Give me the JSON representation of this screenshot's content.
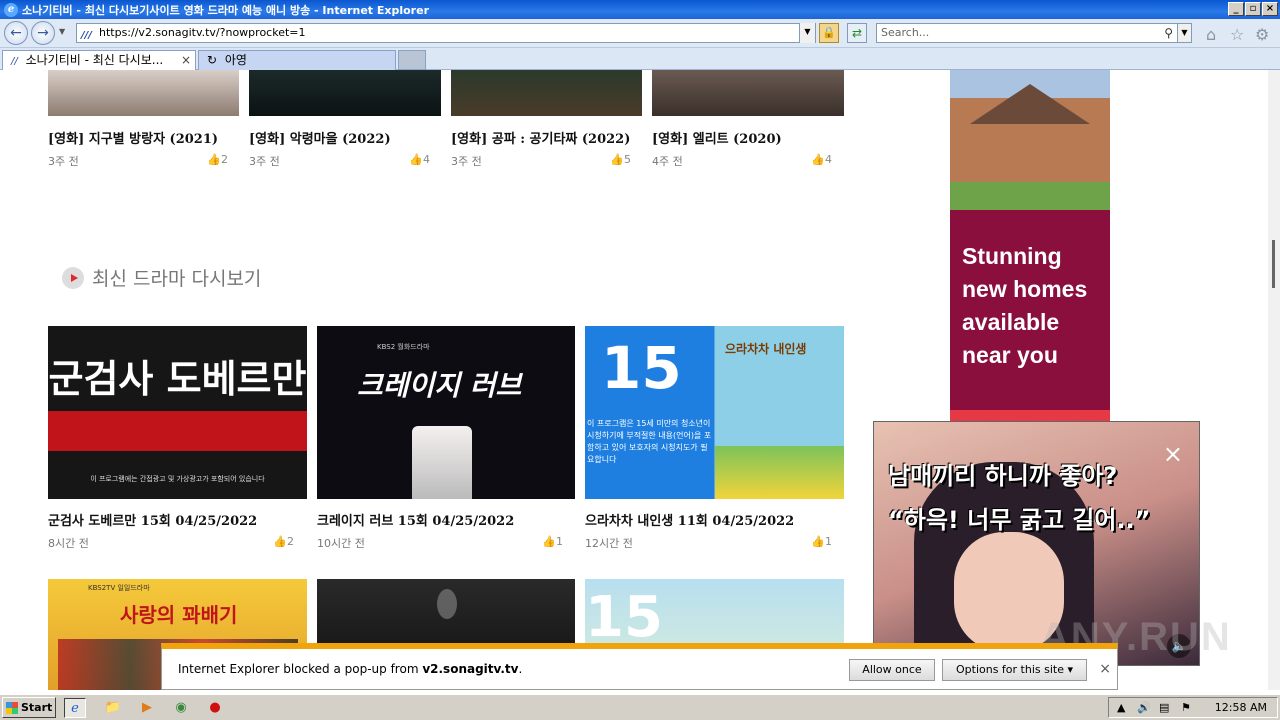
{
  "window": {
    "title": "소나기티비 - 최신 다시보기사이트 영화 드라마 예능 애니 방송 - Internet Explorer",
    "controls": [
      "_",
      "▫",
      "×"
    ]
  },
  "addressbar": {
    "url": "https://v2.sonagitv.tv/?nowprocket=1",
    "search_placeholder": "Search..."
  },
  "tabs": [
    {
      "label": "소나기티비 - 최신 다시보...",
      "active": true
    },
    {
      "label": "아영",
      "active": false
    }
  ],
  "top_movies": [
    {
      "title": "[영화] 지구별 방랑자 (2021)",
      "time": "3주 전",
      "likes": "2"
    },
    {
      "title": "[영화] 악령마을 (2022)",
      "time": "3주 전",
      "likes": "4"
    },
    {
      "title": "[영화] 공파 : 공기타짜 (2022)",
      "time": "3주 전",
      "likes": "5"
    },
    {
      "title": "[영화] 엘리트 (2020)",
      "time": "4주 전",
      "likes": "4"
    }
  ],
  "section": {
    "title": "최신 드라마 다시보기"
  },
  "dramas": [
    {
      "title": "군검사 도베르만 15회 04/25/2022",
      "time": "8시간 전",
      "likes": "2",
      "poster_text": "군검사 도베르만",
      "poster_sub": "이 프로그램에는 간접광고 및 가상광고가 포함되어 있습니다",
      "color": "#1a1a1a"
    },
    {
      "title": "크레이지 러브 15회 04/25/2022",
      "time": "10시간 전",
      "likes": "1",
      "poster_text": "크레이지 러브",
      "poster_sub": "KBS2 월화드라마",
      "color": "#0d0d12"
    },
    {
      "title": "으라차차 내인생 11회 04/25/2022",
      "time": "12시간 전",
      "likes": "1",
      "poster_text": "15",
      "poster_sub": "이 프로그램은 15세 미만의 청소년이 시청하기에 부적절한 내용(언어)을 포함하고 있어 보호자의 시청지도가 필요합니다",
      "poster_title2": "으라차차 내인생",
      "color": "#1e6fd0"
    }
  ],
  "row3": [
    {
      "poster_text": "사랑의 꽈배기",
      "poster_sub": "KBS2TV 일일드라마"
    },
    {
      "poster_text": ""
    },
    {
      "poster_text": "15"
    }
  ],
  "ad": {
    "text": "Stunning new homes available near you"
  },
  "popup_ad": {
    "line1": "남매끼리 하니까 좋아?",
    "line2": "“하윽! 너무 굵고 길어..”"
  },
  "watermark": "ANY.RUN",
  "notification": {
    "message_prefix": "Internet Explorer blocked a pop-up from ",
    "domain": "v2.sonagitv.tv",
    "message_suffix": ".",
    "allow_label": "Allow once",
    "options_label": "Options for this site ▾"
  },
  "taskbar": {
    "start_label": "Start",
    "clock": "12:58 AM"
  }
}
